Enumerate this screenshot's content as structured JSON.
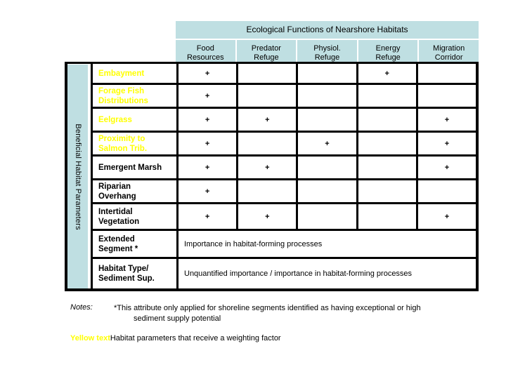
{
  "table": {
    "header_title": "Ecological Functions of Nearshore Habitats",
    "columns": [
      {
        "line1": "Food",
        "line2": "Resources"
      },
      {
        "line1": "Predator",
        "line2": "Refuge"
      },
      {
        "line1": "Physiol.",
        "line2": "Refuge"
      },
      {
        "line1": "Energy",
        "line2": "Refuge"
      },
      {
        "line1": "Migration",
        "line2": "Corridor"
      }
    ],
    "vertical_axis_label": "Beneficial Habitat Parameters",
    "mark": "+",
    "rows": [
      {
        "label_line1": "Embayment",
        "label_line2": "",
        "yellow": true,
        "marks": [
          "+",
          "",
          "",
          "+",
          ""
        ]
      },
      {
        "label_line1": "Forage Fish",
        "label_line2": "Distributions",
        "yellow": true,
        "marks": [
          "+",
          "",
          "",
          "",
          ""
        ]
      },
      {
        "label_line1": "Eelgrass",
        "label_line2": "",
        "yellow": true,
        "marks": [
          "+",
          "+",
          "",
          "",
          "+"
        ]
      },
      {
        "label_line1": "Proximity to",
        "label_line2": "Salmon Trib.",
        "yellow": true,
        "marks": [
          "+",
          "",
          "+",
          "",
          "+"
        ]
      },
      {
        "label_line1": "Emergent Marsh",
        "label_line2": "",
        "yellow": false,
        "marks": [
          "+",
          "+",
          "",
          "",
          "+"
        ]
      },
      {
        "label_line1": "Riparian",
        "label_line2": "Overhang",
        "yellow": false,
        "marks": [
          "+",
          "",
          "",
          "",
          ""
        ]
      },
      {
        "label_line1": "Intertidal",
        "label_line2": "Vegetation",
        "yellow": false,
        "marks": [
          "+",
          "+",
          "",
          "",
          "+"
        ]
      }
    ],
    "span_rows": [
      {
        "label_line1": "Extended",
        "label_line2": "Segment *",
        "yellow": false,
        "text": "Importance in habitat-forming processes"
      },
      {
        "label_line1": "Habitat Type/",
        "label_line2": "Sediment Sup.",
        "yellow": false,
        "text": "Unquantified importance / importance in habitat-forming processes"
      }
    ]
  },
  "notes": {
    "label": "Notes:",
    "asterisk": "*",
    "note1_line1": "This attribute only applied for shoreline segments identified as having exceptional or high",
    "note1_line2": "sediment supply potential",
    "note2_key": "Yellow text",
    "note2_text": "Habitat parameters that receive a weighting factor"
  },
  "colors": {
    "header_band": "#bfdfe2",
    "yellow_text": "#ffff00",
    "border": "#000000",
    "background": "#ffffff"
  }
}
